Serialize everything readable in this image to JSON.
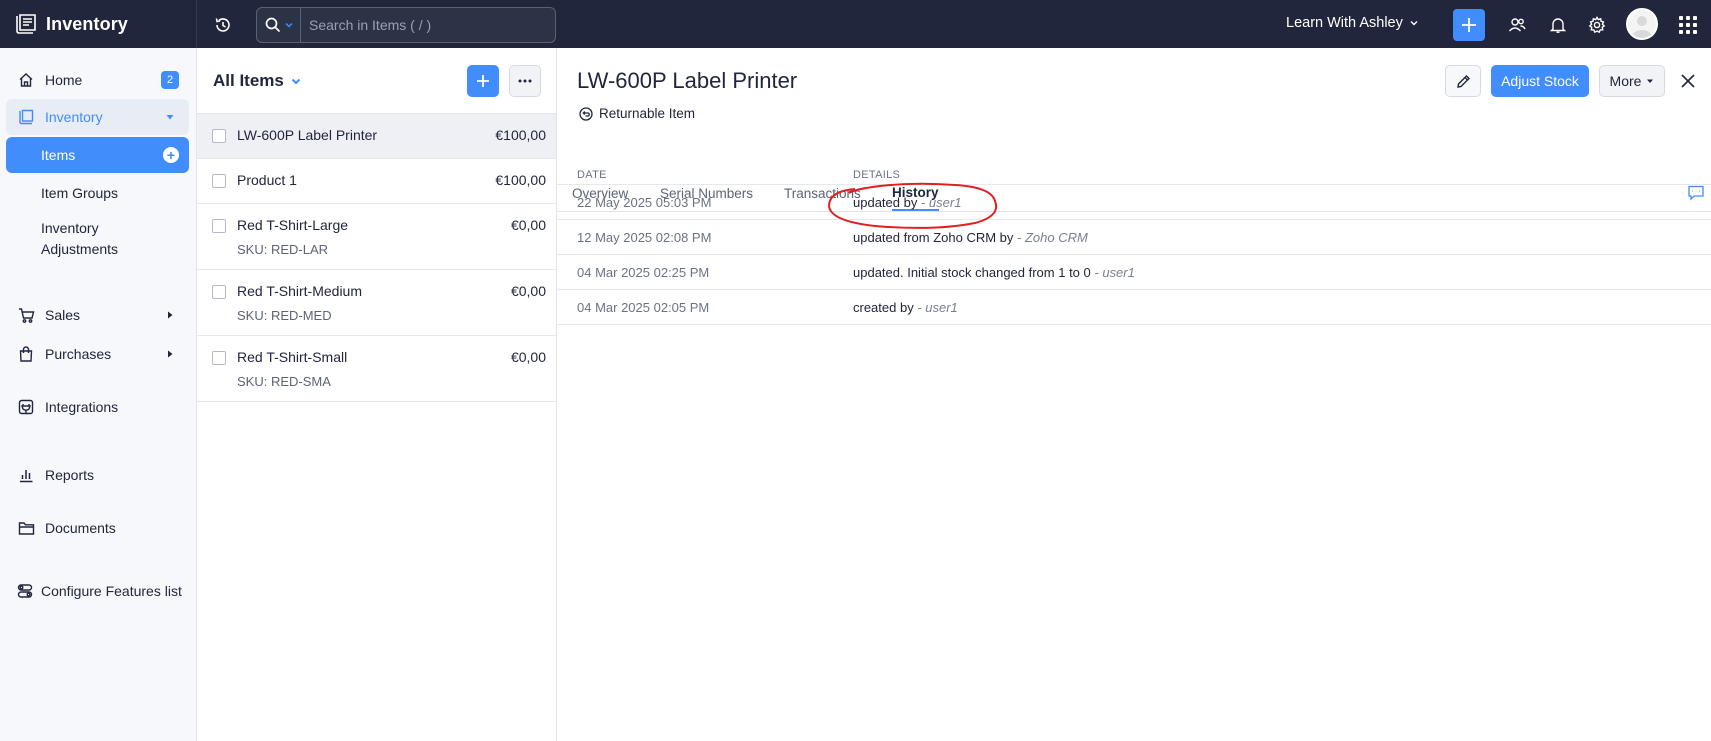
{
  "app": {
    "name": "Inventory"
  },
  "topbar": {
    "search_placeholder": "Search in Items ( / )",
    "org_name": "Learn With Ashley",
    "icons": [
      "history-icon",
      "search-icon",
      "plus-icon",
      "people-icon",
      "bell-icon",
      "gear-icon",
      "avatar",
      "apps-grid-icon"
    ]
  },
  "sidebar": {
    "home": {
      "label": "Home",
      "badge": "2"
    },
    "inventory": {
      "label": "Inventory"
    },
    "items": {
      "label": "Items"
    },
    "item_groups": {
      "label": "Item Groups"
    },
    "inventory_adjustments": {
      "line1": "Inventory",
      "line2": "Adjustments"
    },
    "sales": {
      "label": "Sales"
    },
    "purchases": {
      "label": "Purchases"
    },
    "integrations": {
      "label": "Integrations"
    },
    "reports": {
      "label": "Reports"
    },
    "documents": {
      "label": "Documents"
    },
    "configure": {
      "label": "Configure Features list"
    }
  },
  "list": {
    "title": "All Items",
    "items": [
      {
        "name": "LW-600P Label Printer",
        "price": "€100,00",
        "sku": ""
      },
      {
        "name": "Product 1",
        "price": "€100,00",
        "sku": ""
      },
      {
        "name": "Red T-Shirt-Large",
        "price": "€0,00",
        "sku": "SKU: RED-LAR"
      },
      {
        "name": "Red T-Shirt-Medium",
        "price": "€0,00",
        "sku": "SKU: RED-MED"
      },
      {
        "name": "Red T-Shirt-Small",
        "price": "€0,00",
        "sku": "SKU: RED-SMA"
      }
    ]
  },
  "detail": {
    "title": "LW-600P Label Printer",
    "returnable": "Returnable Item",
    "adjust_stock": "Adjust Stock",
    "more": "More",
    "tabs": [
      "Overview",
      "Serial Numbers",
      "Transactions",
      "History"
    ],
    "active_tab": "History",
    "history": {
      "col_date": "DATE",
      "col_details": "DETAILS",
      "rows": [
        {
          "date": "22 May 2025 05:03 PM",
          "text": "updated by",
          "who": "- user1"
        },
        {
          "date": "12 May 2025 02:08 PM",
          "text": "updated from Zoho CRM by",
          "who": "- Zoho CRM"
        },
        {
          "date": "04 Mar 2025 02:25 PM",
          "text": "updated. Initial stock changed from 1 to 0",
          "who": "- user1"
        },
        {
          "date": "04 Mar 2025 02:05 PM",
          "text": "created by",
          "who": "- user1"
        }
      ]
    }
  },
  "colors": {
    "topbar": "#21263c",
    "accent": "#408dfb",
    "annotation": "#e02020"
  }
}
